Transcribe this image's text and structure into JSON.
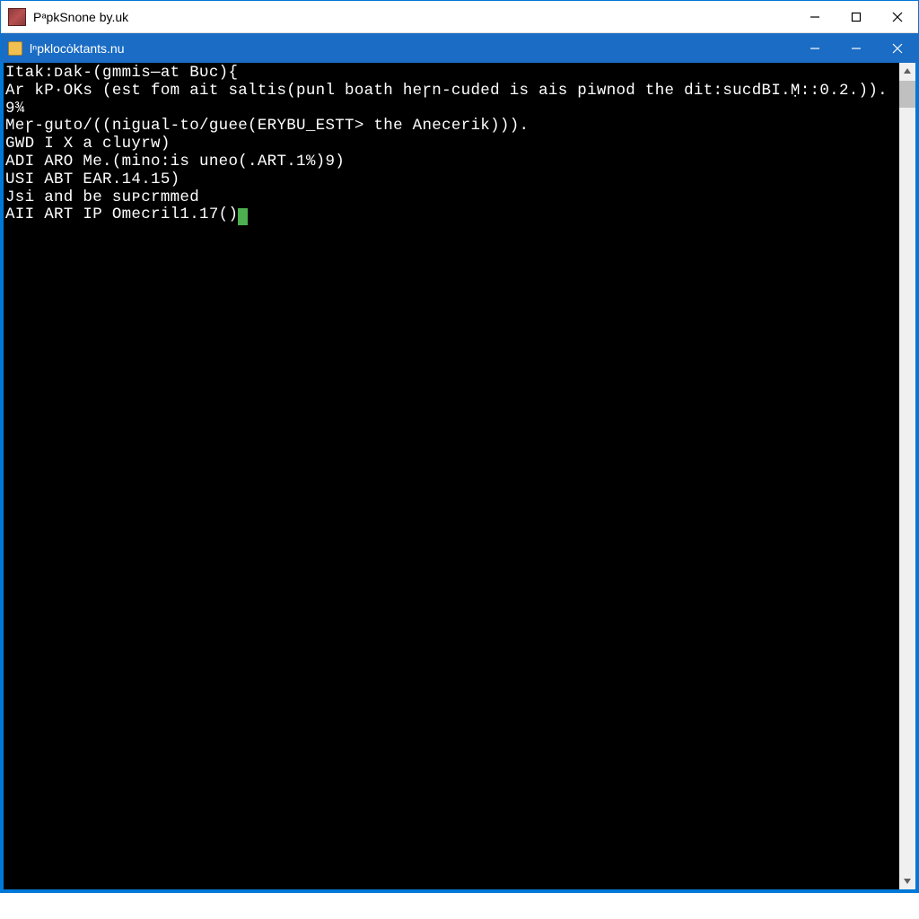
{
  "outer_window": {
    "title": "PᵃpkSnone by.uk"
  },
  "inner_window": {
    "title": "lⁿpklocȯktants.nu"
  },
  "terminal": {
    "lines": [
      "Itak:ᴅak-(gmmis—at Bᴜc){",
      "Ar kP·OKs (est fom ait saltis(punl boath heɼn-cuded is ais piwnod the dit:sucdBI.Ṃ::0.2.)).",
      "9¾",
      "Meɼ-guto/((nigual-to/guee(ERYBU_ESTT> the Anecerik))).",
      "",
      "GWD I X a cluyrw)",
      "ADI ARO Me.(mino:is uneo(.ART.1%)9)",
      "USI ABT EAR.14.15)",
      "Jsi and be suᴘcrmmed",
      "AII ART IP Omecril1.17()"
    ]
  }
}
